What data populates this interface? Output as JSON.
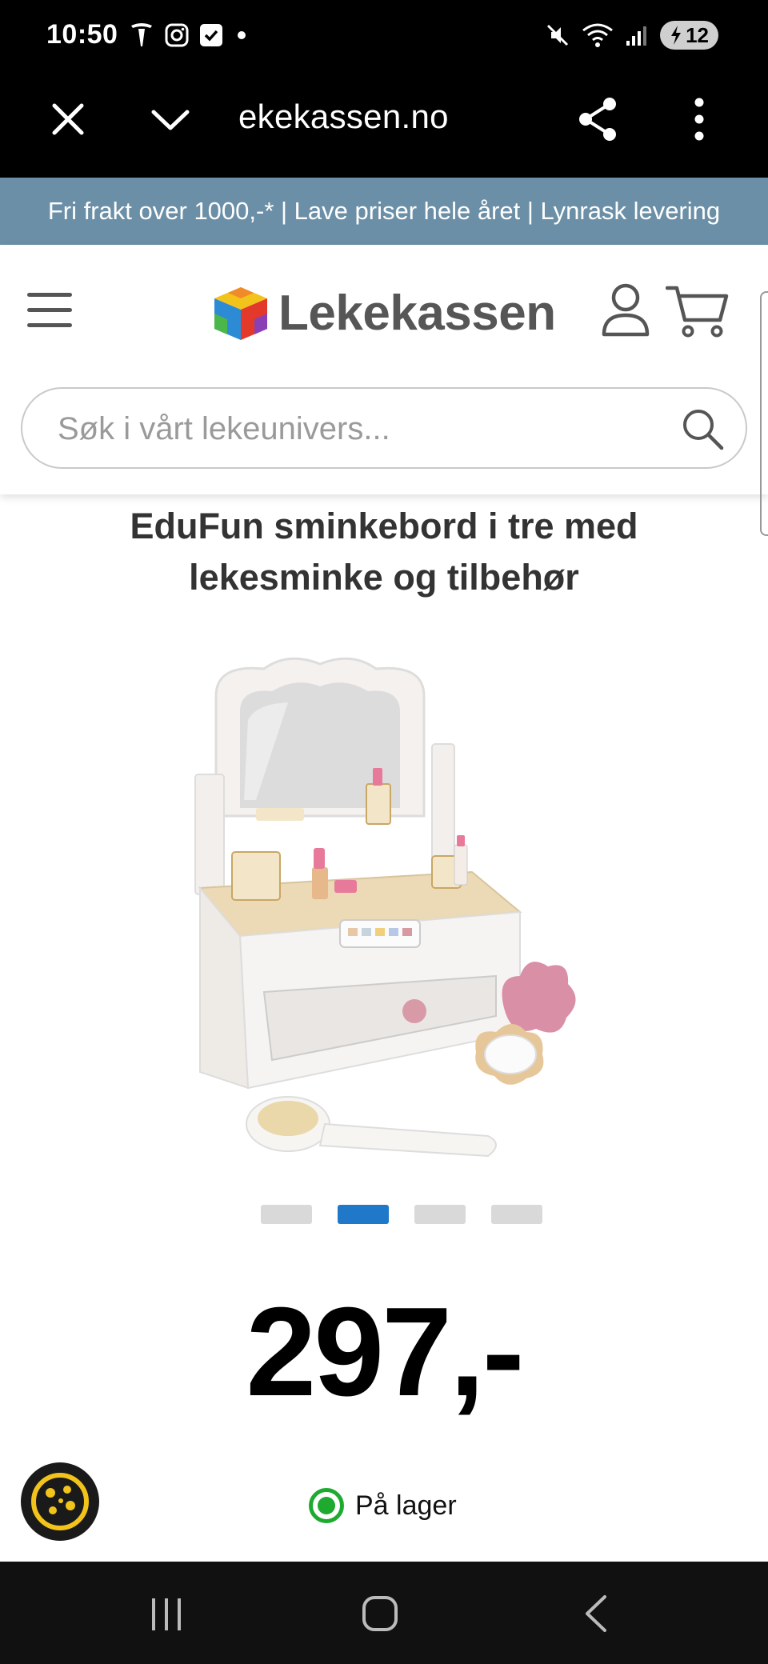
{
  "status_bar": {
    "time": "10:50",
    "battery": "12",
    "icons_left": [
      "tesla-icon",
      "instagram-icon",
      "check-icon",
      "dot-icon"
    ],
    "icons_right": [
      "mute-icon",
      "wifi-icon",
      "signal-icon",
      "battery-icon"
    ]
  },
  "browser": {
    "url": "ekekassen.no",
    "icons": [
      "close-icon",
      "chevron-down-icon",
      "share-icon",
      "more-icon"
    ]
  },
  "promo": {
    "text": "Fri frakt over 1000,-* | Lave priser hele året | Lynrask levering"
  },
  "header": {
    "logo_text": "Lekekassen",
    "search_placeholder": "Søk i vårt lekeunivers..."
  },
  "product": {
    "title": "EduFun sminkebord i tre med lekesminke og tilbehør",
    "price": "297,-",
    "stock_status": "På lager",
    "carousel": {
      "count": 4,
      "active_index": 1
    }
  },
  "colors": {
    "promo_bg": "#6b8fa6",
    "active_dot": "#1f78c8",
    "in_stock": "#1eaa2f"
  }
}
